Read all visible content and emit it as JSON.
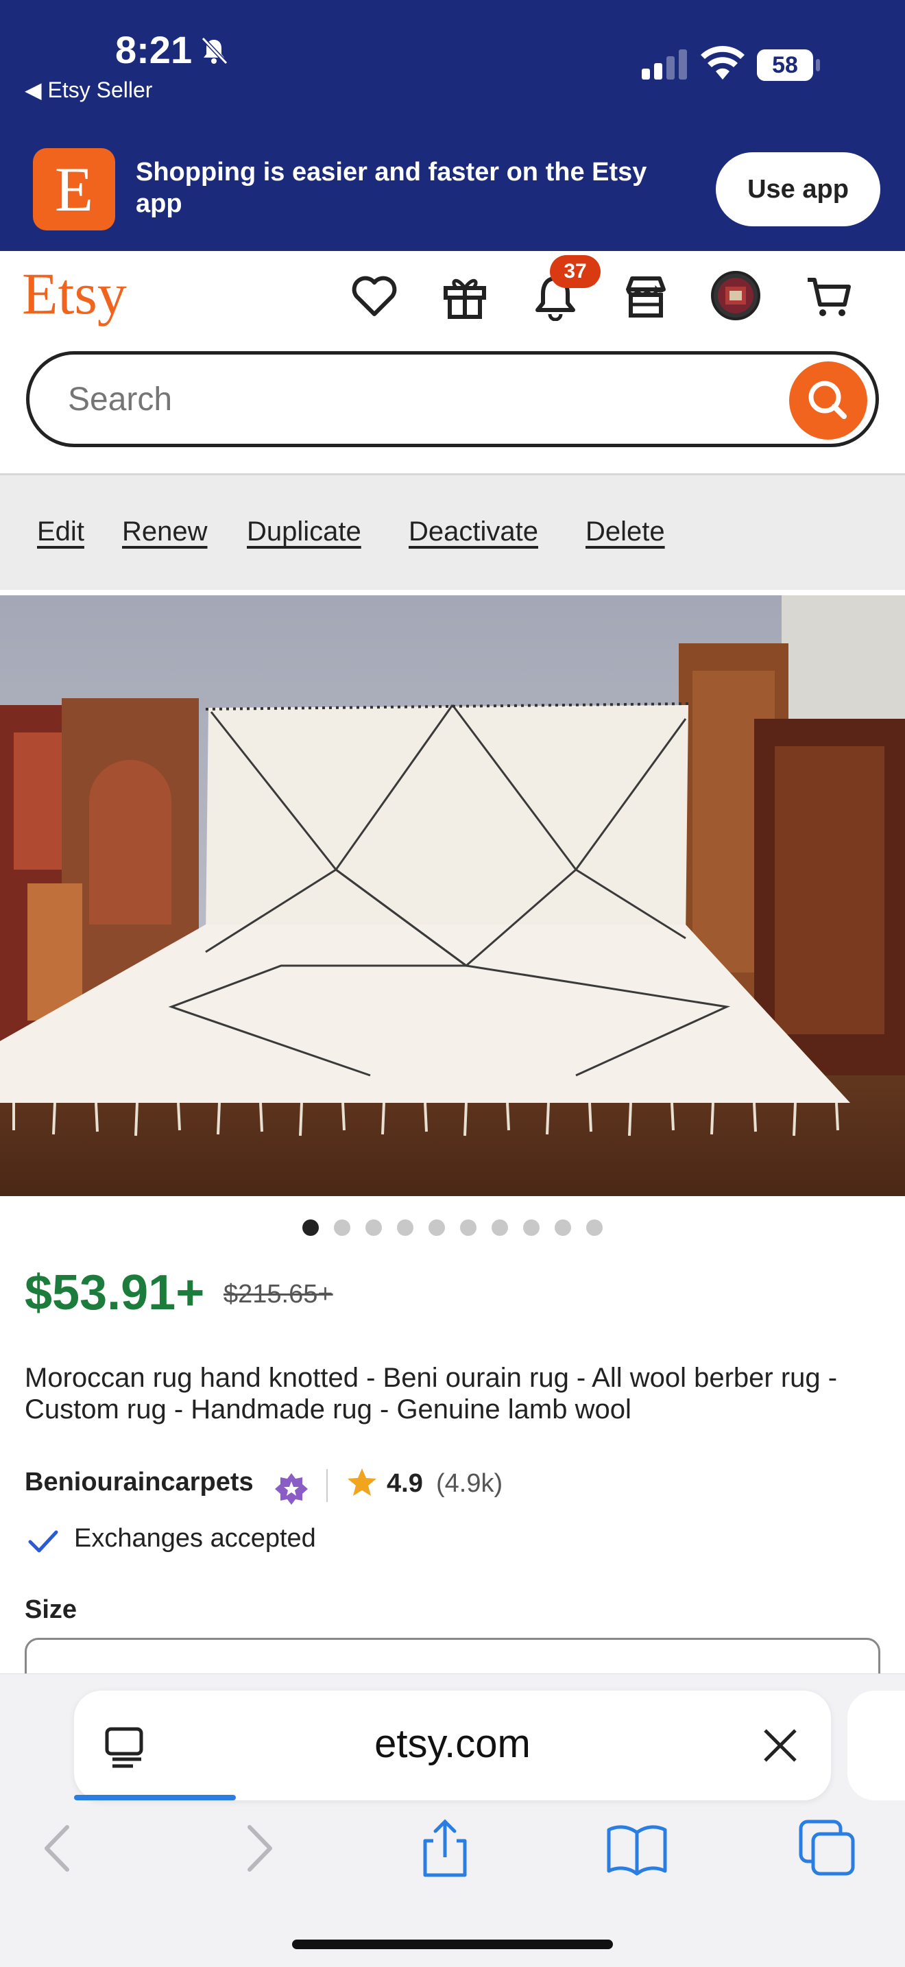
{
  "status_bar": {
    "time": "8:21",
    "back_app": "◀ Etsy Seller",
    "battery": "58"
  },
  "banner": {
    "text": "Shopping is easier and faster on the Etsy app",
    "button": "Use app",
    "app_icon_letter": "E"
  },
  "header": {
    "logo": "Etsy",
    "notifications_count": "37",
    "icons": [
      "heart-icon",
      "gift-icon",
      "bell-icon",
      "shop-icon",
      "avatar",
      "cart-icon"
    ]
  },
  "search": {
    "placeholder": "Search"
  },
  "seller_actions": [
    "Edit",
    "Renew",
    "Duplicate",
    "Deactivate",
    "Delete"
  ],
  "gallery": {
    "total_images": 10,
    "active_index": 0
  },
  "listing": {
    "price": "$53.91+",
    "original_price": "$215.65+",
    "title": "Moroccan rug hand knotted - Beni ourain rug - All wool berber rug - Custom rug - Handmade rug - Genuine lamb wool",
    "shop_name": "Beniouraincarpets",
    "rating": "4.9",
    "review_count": "(4.9k)",
    "exchanges": "Exchanges accepted",
    "size_label": "Size"
  },
  "browser": {
    "url": "etsy.com"
  },
  "colors": {
    "brand_orange": "#f1641e",
    "header_blue": "#1b2a7a",
    "price_green": "#1c7c3b",
    "badge_red": "#d93a12",
    "safari_blue": "#2a7de1"
  }
}
